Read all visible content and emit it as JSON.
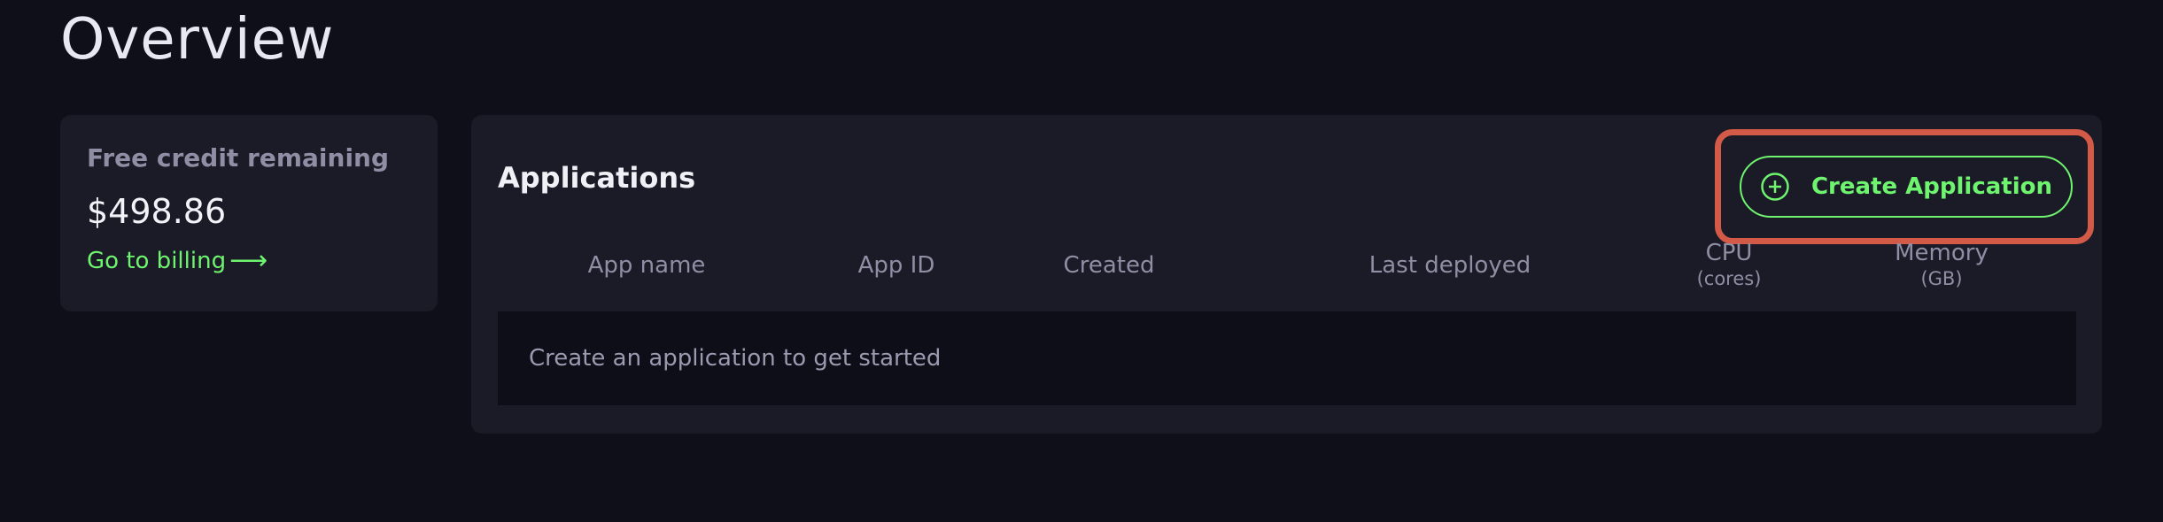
{
  "page": {
    "title": "Overview"
  },
  "credit": {
    "label": "Free credit remaining",
    "amount": "$498.86",
    "billing_link": "Go to billing"
  },
  "applications": {
    "title": "Applications",
    "create_button": "Create Application",
    "columns": [
      {
        "label": "App name",
        "sub": ""
      },
      {
        "label": "App ID",
        "sub": ""
      },
      {
        "label": "Created",
        "sub": ""
      },
      {
        "label": "Last deployed",
        "sub": ""
      },
      {
        "label": "CPU",
        "sub": "(cores)"
      },
      {
        "label": "Memory",
        "sub": "(GB)"
      }
    ],
    "empty_message": "Create an application to get started"
  },
  "colors": {
    "background": "#0e0f18",
    "card": "#1a1b26",
    "accent_green": "#6ef46e",
    "highlight_red": "#d45a48"
  },
  "icons": {
    "create": "plus-circle-icon",
    "billing": "arrow-right-icon"
  }
}
